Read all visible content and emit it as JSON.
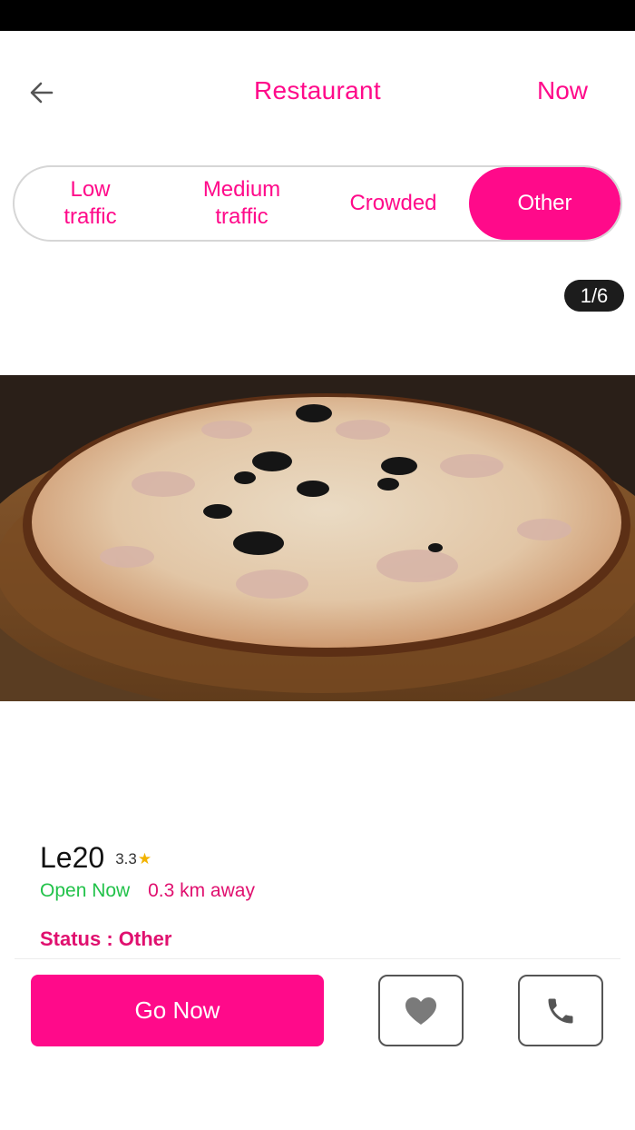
{
  "header": {
    "back_icon": "arrow-left-icon",
    "title": "Restaurant",
    "now_label": "Now"
  },
  "traffic_filter": {
    "options": [
      {
        "line1": "Low",
        "line2": "traffic"
      },
      {
        "line1": "Medium",
        "line2": "traffic"
      },
      {
        "line1": "Crowded",
        "line2": ""
      },
      {
        "line1": "Other",
        "line2": ""
      }
    ],
    "selected": "Other"
  },
  "gallery": {
    "counter": "1/6",
    "current_index": 1,
    "total": 6
  },
  "restaurant": {
    "name": "Le20",
    "rating": "3.3",
    "rating_icon": "star-icon",
    "open_status": "Open Now",
    "distance": "0.3 km away",
    "status_label": "Status : Other"
  },
  "actions": {
    "go_now_label": "Go Now",
    "favorite_icon": "heart-icon",
    "call_icon": "phone-icon"
  },
  "colors": {
    "accent": "#ff0a8a",
    "open": "#22c24a",
    "star": "#f2b300"
  }
}
